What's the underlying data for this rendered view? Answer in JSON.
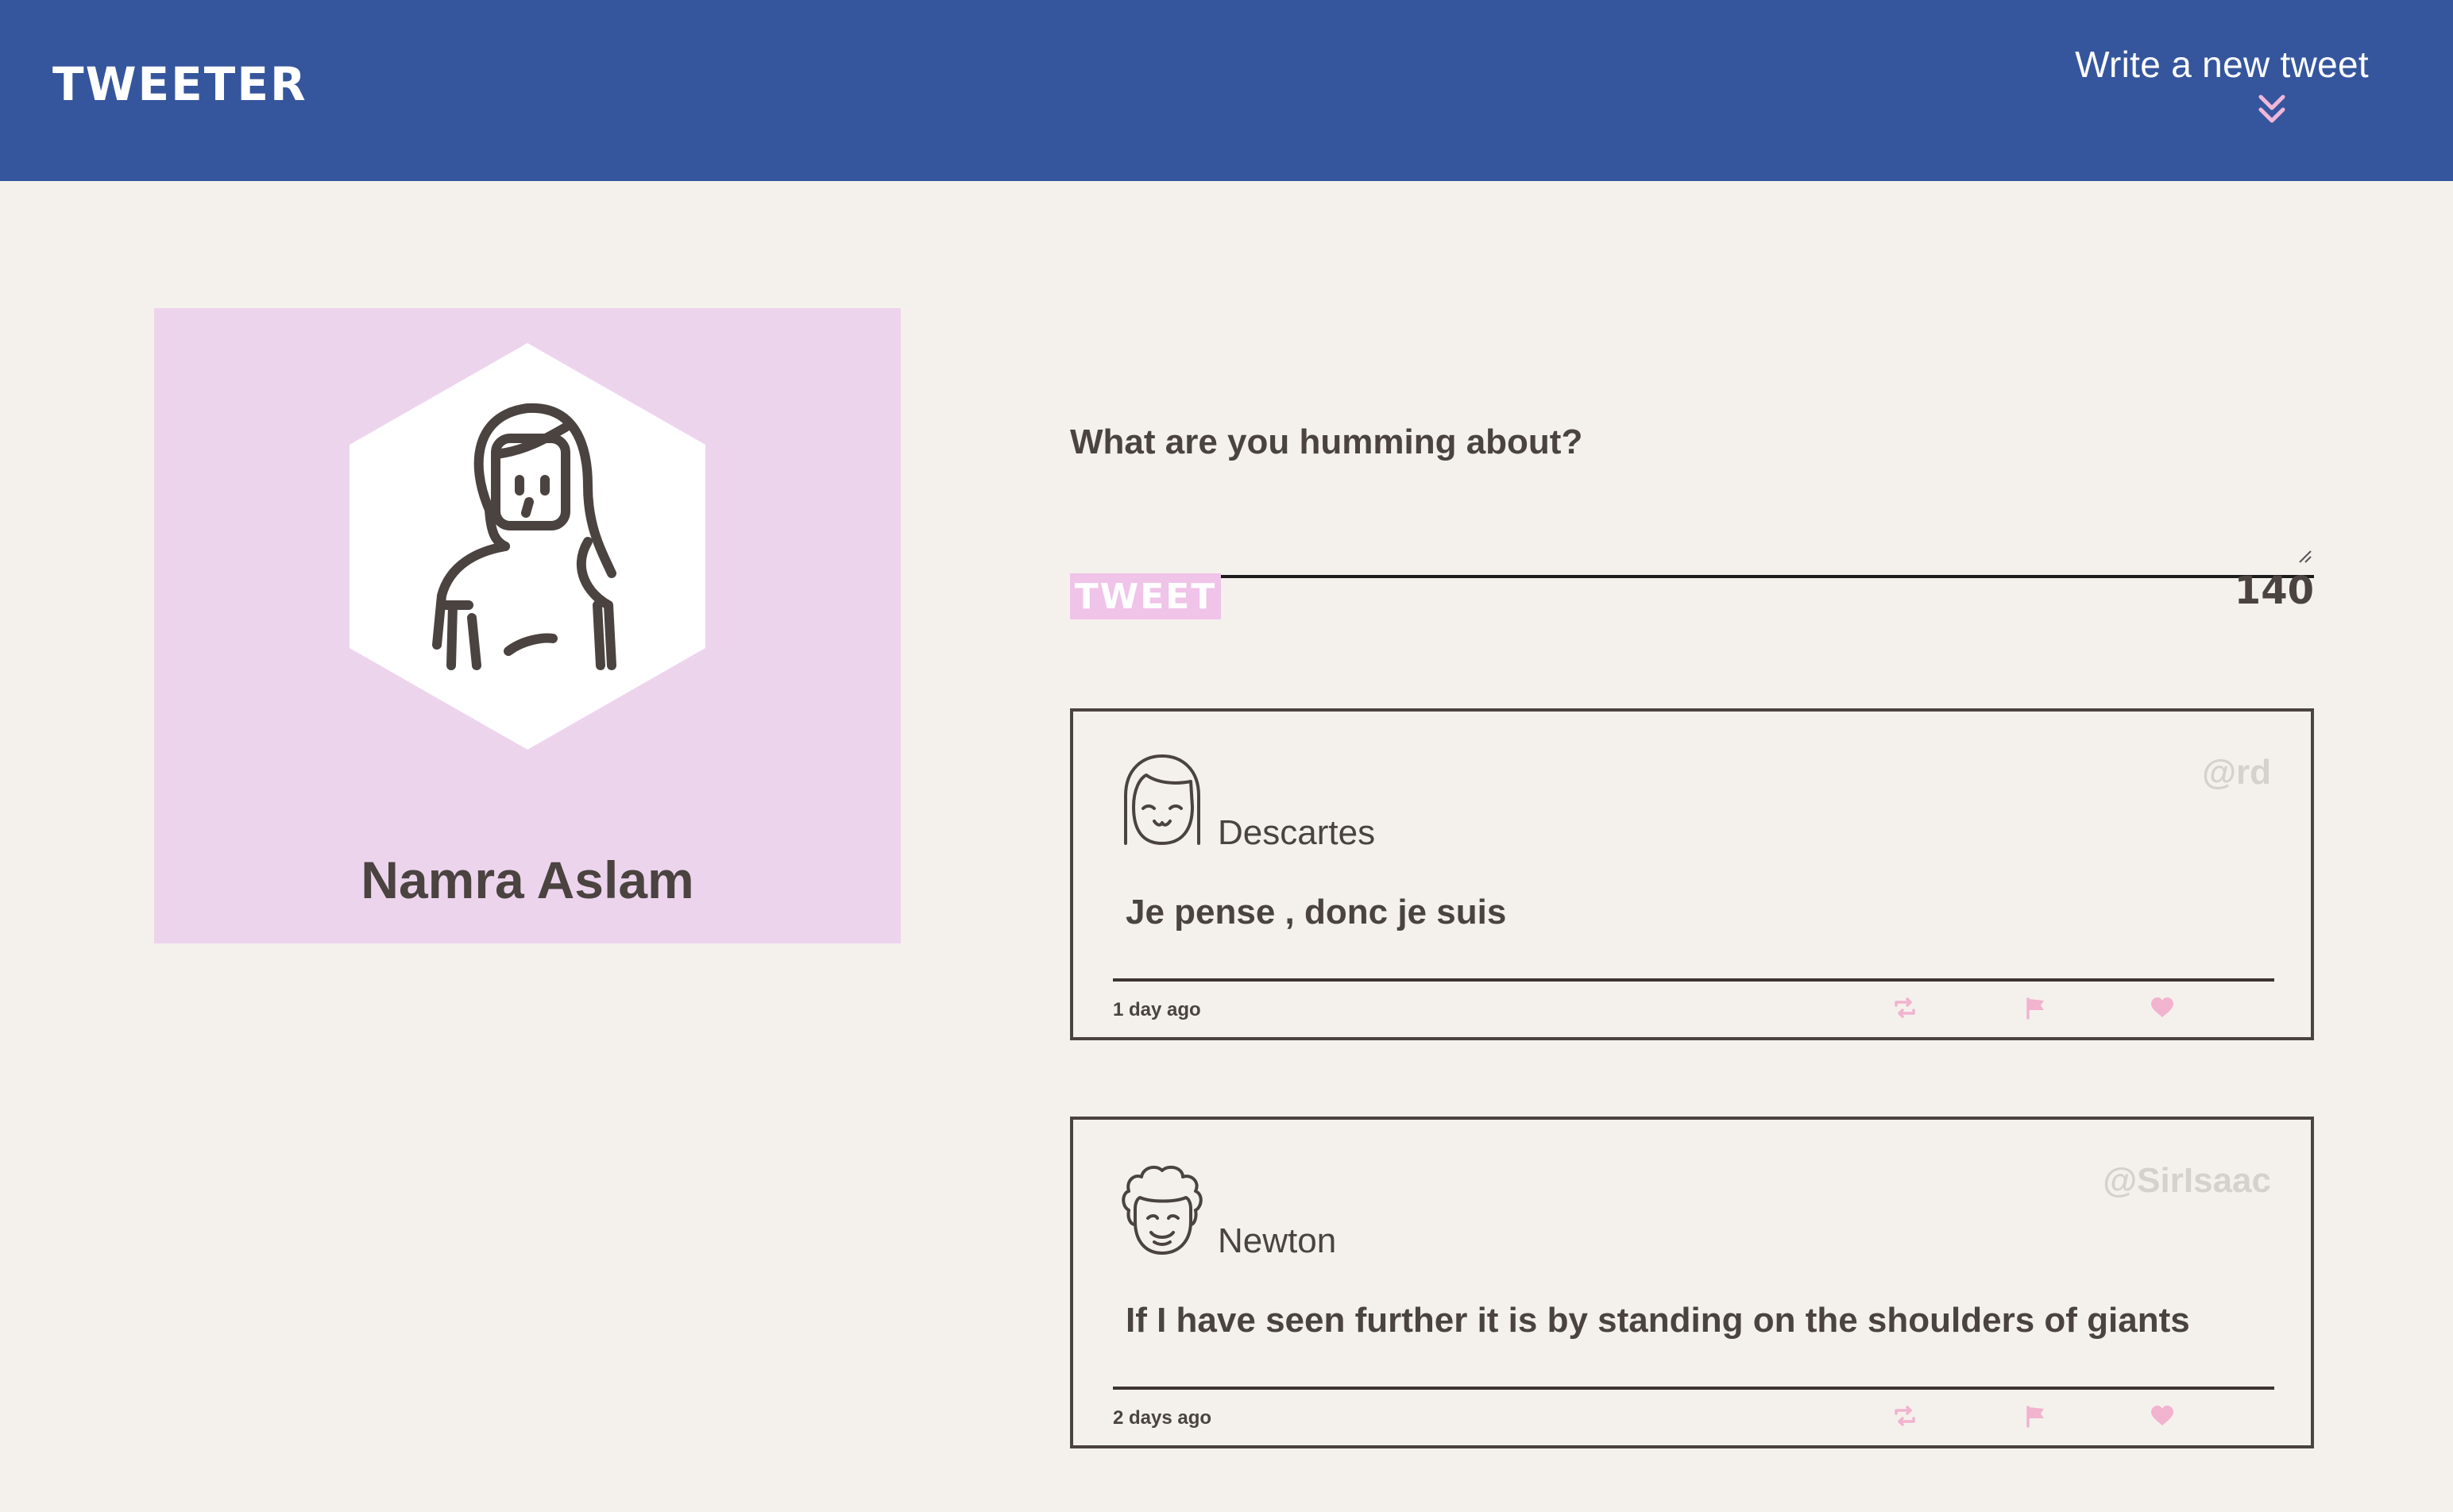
{
  "nav": {
    "brand": "TWEETER",
    "compose_toggle_label": "Write a new tweet",
    "compose_toggle_icon": "double-chevron-down-icon"
  },
  "profile": {
    "name": "Namra Aslam",
    "avatar_icon": "woman-avatar-icon",
    "card_color": "#edd4ed"
  },
  "compose": {
    "label": "What are you humming about?",
    "input_value": "",
    "button_label": "TWEET",
    "counter": "140"
  },
  "tweets": [
    {
      "author": "Descartes",
      "handle": "@rd",
      "content": "Je pense , donc je suis",
      "time": "1 day ago",
      "avatar_icon": "girl-avatar-icon",
      "actions": [
        "retweet-icon",
        "flag-icon",
        "heart-icon"
      ]
    },
    {
      "author": "Newton",
      "handle": "@SirIsaac",
      "content": "If I have seen further it is by standing on the shoulders of giants",
      "time": "2 days ago",
      "avatar_icon": "curly-hair-avatar-icon",
      "actions": [
        "retweet-icon",
        "flag-icon",
        "heart-icon"
      ]
    }
  ],
  "colors": {
    "nav": "#35569d",
    "background": "#f4f1ed",
    "accent_pink": "#f0c3e8",
    "text": "#4a4340",
    "handle": "#d6d1cc"
  }
}
